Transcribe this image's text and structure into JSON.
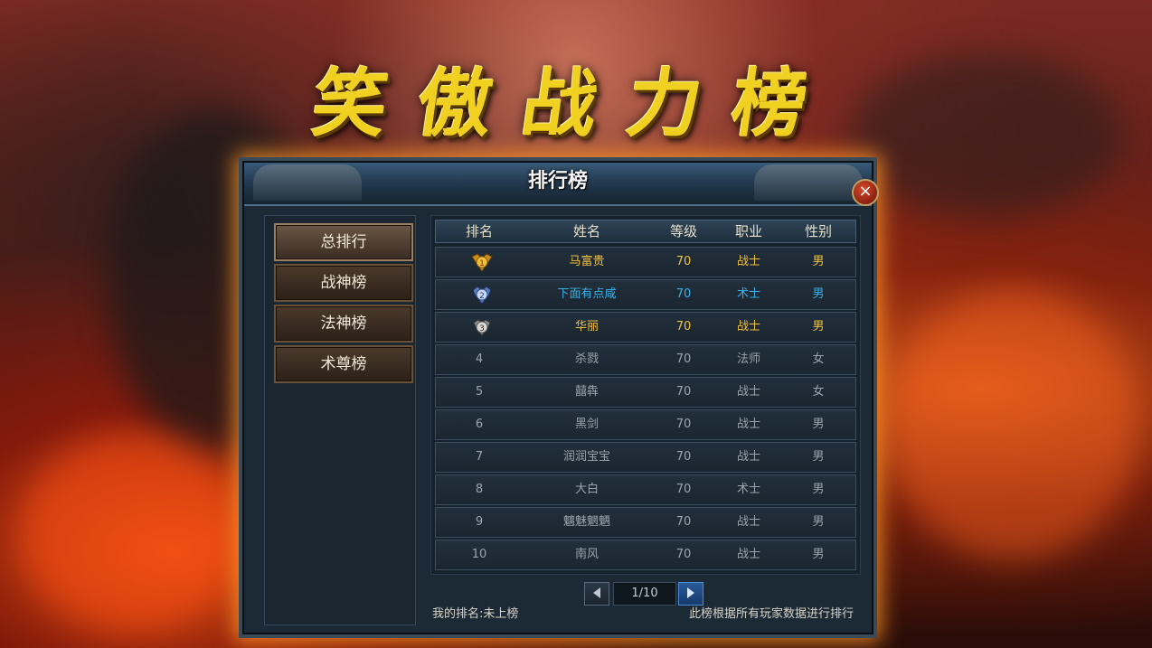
{
  "banner": {
    "title": "笑傲战力榜"
  },
  "panel": {
    "title": "排行榜",
    "close_label": "×"
  },
  "sidebar": {
    "items": [
      {
        "label": "总排行"
      },
      {
        "label": "战神榜"
      },
      {
        "label": "法神榜"
      },
      {
        "label": "术尊榜"
      }
    ]
  },
  "table": {
    "headers": [
      "排名",
      "姓名",
      "等级",
      "职业",
      "性别"
    ],
    "rows": [
      {
        "rank": "",
        "medal": "gold-medal-1",
        "name": "马富贵",
        "level": "70",
        "class": "战士",
        "gender": "男"
      },
      {
        "rank": "",
        "medal": "silver-medal-2",
        "name": "下面有点咸",
        "level": "70",
        "class": "术士",
        "gender": "男"
      },
      {
        "rank": "",
        "medal": "bronze-medal-3",
        "name": "华丽",
        "level": "70",
        "class": "战士",
        "gender": "男"
      },
      {
        "rank": "4",
        "name": "杀戮",
        "level": "70",
        "class": "法师",
        "gender": "女"
      },
      {
        "rank": "5",
        "name": "囍犇",
        "level": "70",
        "class": "战士",
        "gender": "女"
      },
      {
        "rank": "6",
        "name": "黑剑",
        "level": "70",
        "class": "战士",
        "gender": "男"
      },
      {
        "rank": "7",
        "name": "润润宝宝",
        "level": "70",
        "class": "战士",
        "gender": "男"
      },
      {
        "rank": "8",
        "name": "大白",
        "level": "70",
        "class": "术士",
        "gender": "男"
      },
      {
        "rank": "9",
        "name": "魑魅魍魉",
        "level": "70",
        "class": "战士",
        "gender": "男"
      },
      {
        "rank": "10",
        "name": "南风",
        "level": "70",
        "class": "战士",
        "gender": "男"
      }
    ]
  },
  "pager": {
    "page": "1/10"
  },
  "footer": {
    "my_rank": "我的排名:未上榜",
    "note": "此榜根据所有玩家数据进行排行"
  },
  "colors": {
    "title": "#f0d020",
    "gold_text": "#f0c040",
    "blue_text": "#3ab0e8",
    "glow": "#ff9628"
  }
}
